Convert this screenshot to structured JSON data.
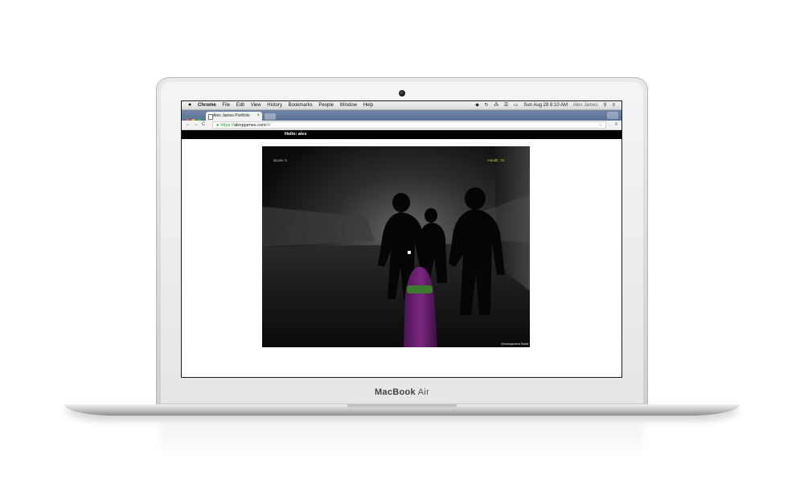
{
  "device": {
    "brand_main": "MacBook",
    "brand_sub": "Air"
  },
  "menubar": {
    "apple": "",
    "app_name": "Chrome",
    "items": [
      "File",
      "Edit",
      "View",
      "History",
      "Bookmarks",
      "People",
      "Window",
      "Help"
    ],
    "clock": "Sun Aug 28  8:10 AM",
    "user": "Alex James"
  },
  "browser": {
    "tab_title": "Alex James Portfolio",
    "tab_close": "×",
    "url_scheme": "https://",
    "url_host": "alexpjames.com",
    "url_path": "/#/",
    "nav_back": "←",
    "nav_forward": "→",
    "nav_reload": "C",
    "menu": "≡",
    "star": "☆"
  },
  "page": {
    "greeting": "Hello: alex",
    "game": {
      "score_label": "Score: 0",
      "health_label": "Health: 70",
      "dev_build": "Development Build"
    }
  },
  "colors": {
    "tabstrip": "#5d7396",
    "game_bg": "#0b0b0b",
    "health_text": "#c6c63a",
    "weapon_purple": "#6a1e6e",
    "weapon_green": "#3a7a2a",
    "traffic_red": "#fc5f57",
    "traffic_yellow": "#fdbc2e",
    "traffic_green": "#28c840"
  }
}
